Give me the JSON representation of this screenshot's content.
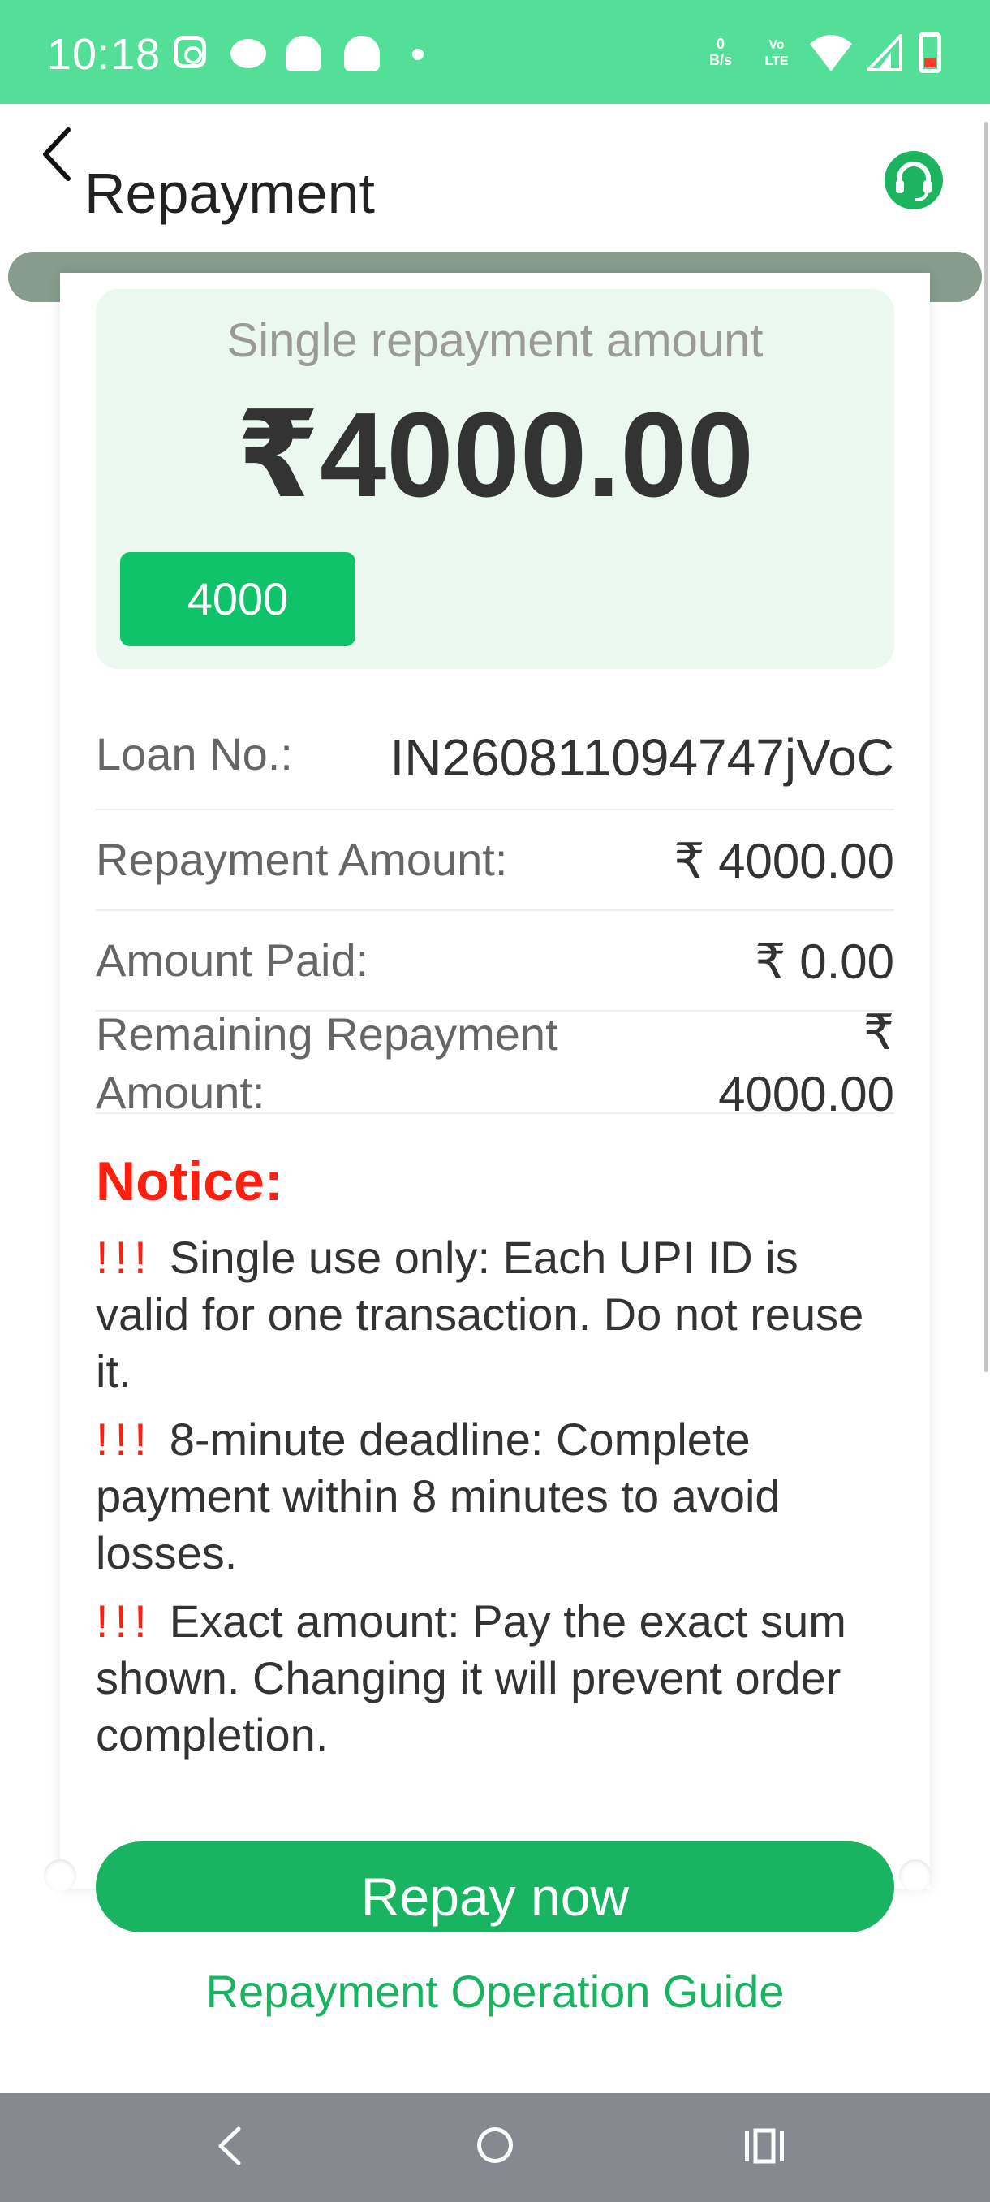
{
  "status_bar": {
    "time": "10:18",
    "network_speed_value": "0",
    "network_speed_unit": "B/s",
    "volte_top": "Vo",
    "volte_bottom": "LTE",
    "icons": [
      "instagram-icon",
      "chat-icon",
      "snapchat-icon",
      "snapchat-icon",
      "dot-icon",
      "wifi-icon",
      "signal-icon",
      "battery-icon"
    ],
    "bg_color": "#54df98"
  },
  "header": {
    "title": "Repayment",
    "back_icon": "chevron-left-icon",
    "support_icon": "headset-icon"
  },
  "amount_card": {
    "label": "Single repayment amount",
    "value": "₹4000.00",
    "chip": "4000"
  },
  "details": [
    {
      "label": "Loan No.:",
      "value": "IN260811094747jVoC"
    },
    {
      "label": "Repayment Amount:",
      "value": "₹ 4000.00"
    },
    {
      "label": "Amount Paid:",
      "value": "₹ 0.00"
    },
    {
      "label": "Remaining Repayment Amount:",
      "value": "₹ 4000.00"
    }
  ],
  "notice": {
    "title": "Notice:",
    "mark": "!!!",
    "items": [
      "Single use only: Each UPI ID is valid for one transaction. Do not reuse it.",
      "8-minute deadline: Complete payment within 8 minutes to avoid losses.",
      "Exact amount: Pay the exact sum shown. Changing it will prevent order completion."
    ]
  },
  "actions": {
    "repay_label": "Repay now",
    "guide_label": "Repayment Operation Guide"
  },
  "colors": {
    "accent_green": "#18b461",
    "notice_red": "#ff1f10",
    "amount_box_bg": "#ebf8f0"
  },
  "nav_bar": {
    "icons": [
      "back-icon",
      "home-icon",
      "recents-icon"
    ]
  }
}
